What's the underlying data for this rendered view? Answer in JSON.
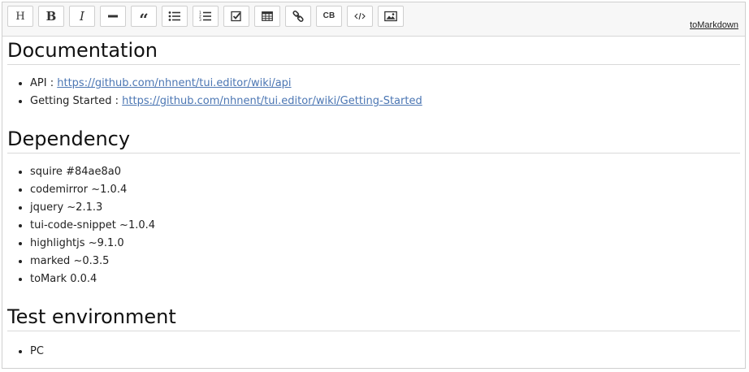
{
  "toolbar": {
    "buttons": [
      {
        "name": "heading",
        "label": "H"
      },
      {
        "name": "bold",
        "label": "B"
      },
      {
        "name": "italic",
        "label": "I"
      },
      {
        "name": "horizontal-rule"
      },
      {
        "name": "quote",
        "label": "“"
      },
      {
        "name": "bullet-list"
      },
      {
        "name": "ordered-list"
      },
      {
        "name": "task-list"
      },
      {
        "name": "table"
      },
      {
        "name": "link"
      },
      {
        "name": "code-block",
        "label": "CB"
      },
      {
        "name": "code"
      },
      {
        "name": "image"
      }
    ],
    "mode_switch_label": "toMarkdown"
  },
  "content": {
    "documentation": {
      "heading": "Documentation",
      "items": [
        {
          "label": "API",
          "sep": " : ",
          "link": "https://github.com/nhnent/tui.editor/wiki/api"
        },
        {
          "label": "Getting Started",
          "sep": " : ",
          "link": "https://github.com/nhnent/tui.editor/wiki/Getting-Started"
        }
      ]
    },
    "dependency": {
      "heading": "Dependency",
      "items": [
        {
          "name": "squire",
          "version": "#84ae8a0"
        },
        {
          "name": "codemirror",
          "version": "~1.0.4"
        },
        {
          "name": "jquery",
          "version": "~2.1.3"
        },
        {
          "name": "tui-code-snippet",
          "version": "~1.0.4"
        },
        {
          "name": "highlightjs",
          "version": "~9.1.0"
        },
        {
          "name": "marked",
          "version": "~0.3.5"
        },
        {
          "name": "toMark",
          "version": "0.0.4"
        }
      ]
    },
    "test_environment": {
      "heading": "Test environment",
      "items": [
        {
          "label": "PC"
        }
      ]
    }
  },
  "colors": {
    "link": "#4b76b3",
    "toolbar_bg": "#f7f7f7",
    "border": "#cfcfcf"
  }
}
